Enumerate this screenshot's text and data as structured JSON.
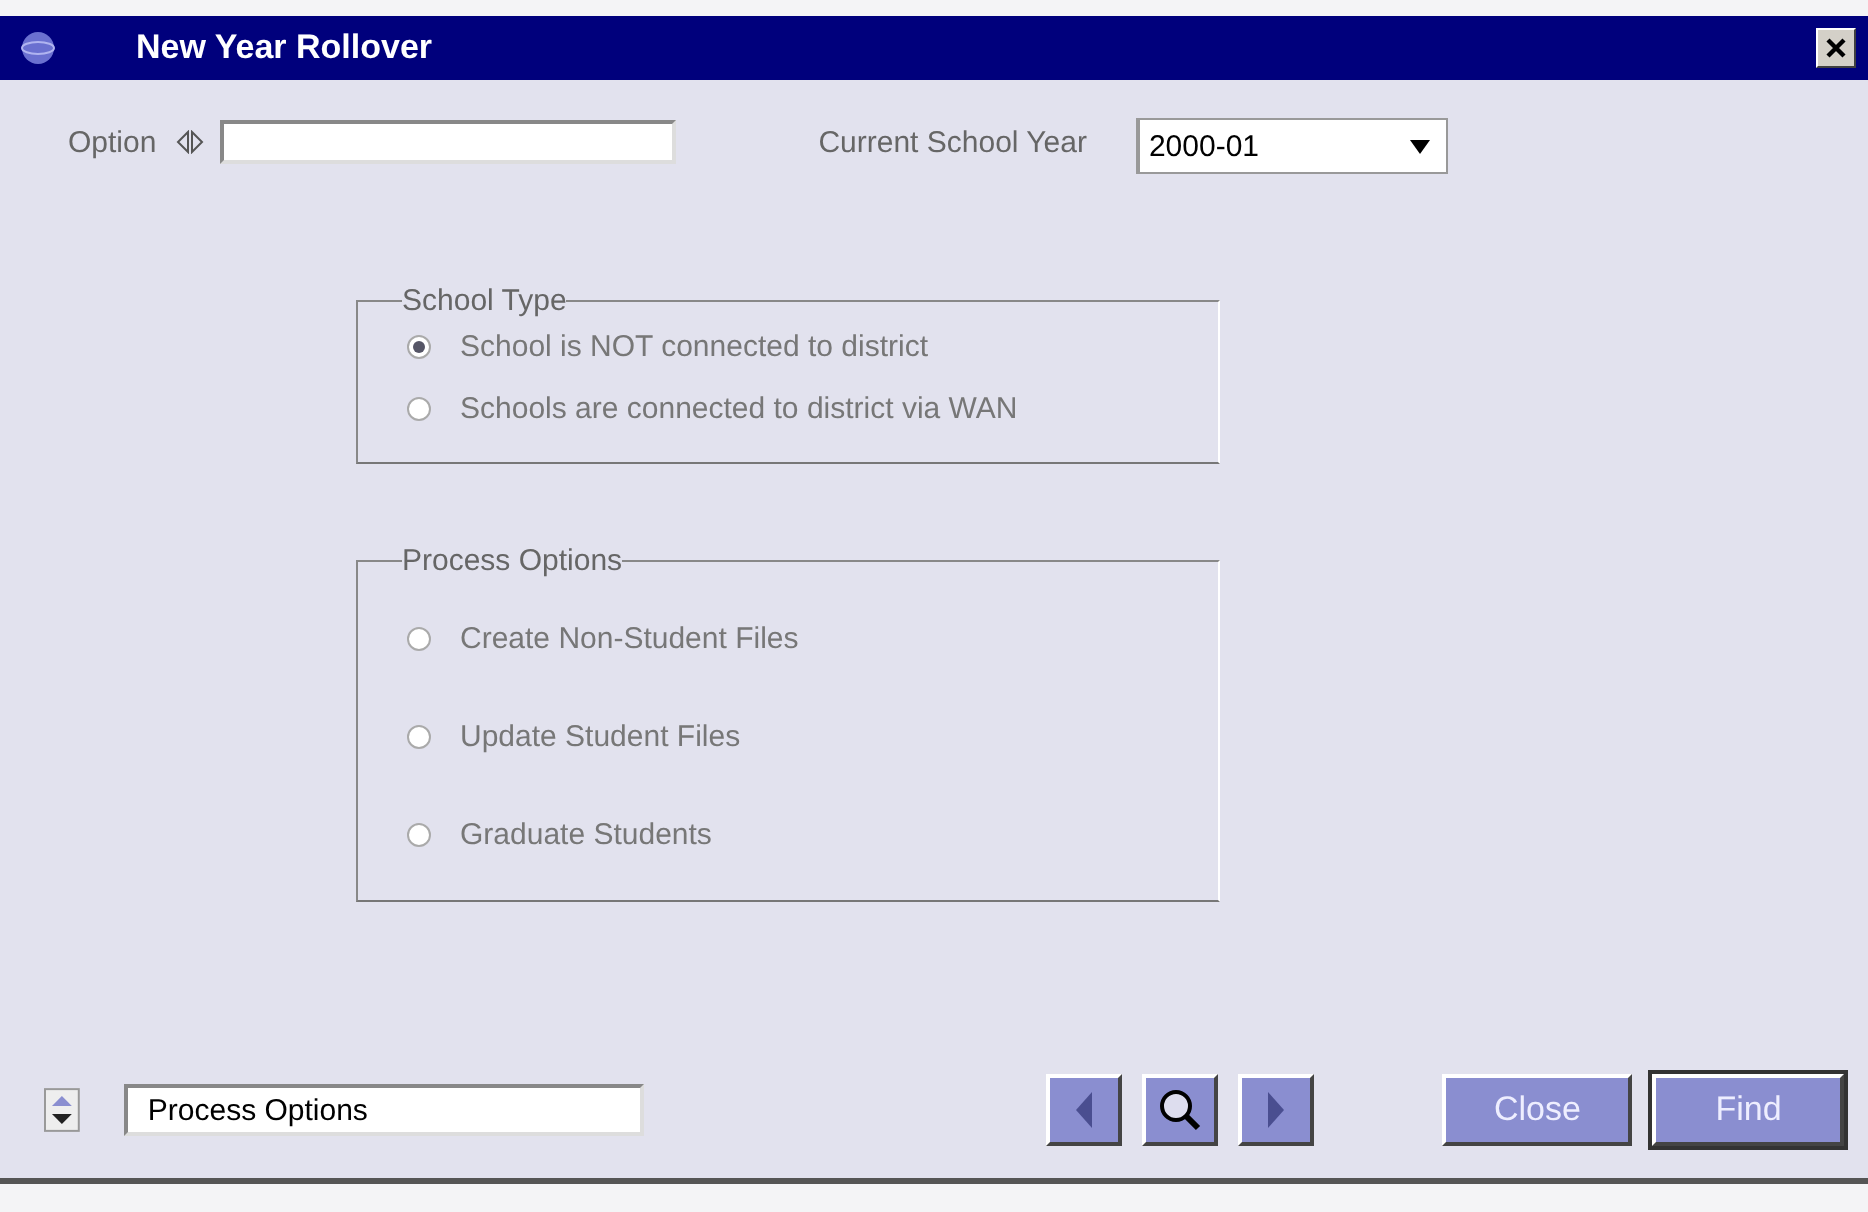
{
  "window": {
    "title": "New Year Rollover"
  },
  "option": {
    "label": "Option"
  },
  "school_year": {
    "label": "Current School Year",
    "value": "2000-01"
  },
  "groups": [
    {
      "title": "School Type",
      "options": [
        {
          "label": "School is NOT connected to district",
          "selected": true,
          "disabled": true
        },
        {
          "label": "Schools are connected to district via WAN",
          "selected": false,
          "disabled": true
        }
      ]
    },
    {
      "title": "Process Options",
      "options": [
        {
          "label": "Create Non-Student Files",
          "selected": false,
          "disabled": true
        },
        {
          "label": "Update Student Files",
          "selected": false,
          "disabled": true
        },
        {
          "label": "Graduate Students",
          "selected": false,
          "disabled": true
        }
      ]
    }
  ],
  "footer": {
    "selector_value": "Process Options"
  },
  "buttons": [
    {
      "label": "Close",
      "default": false
    },
    {
      "label": "Find",
      "default": true
    }
  ]
}
